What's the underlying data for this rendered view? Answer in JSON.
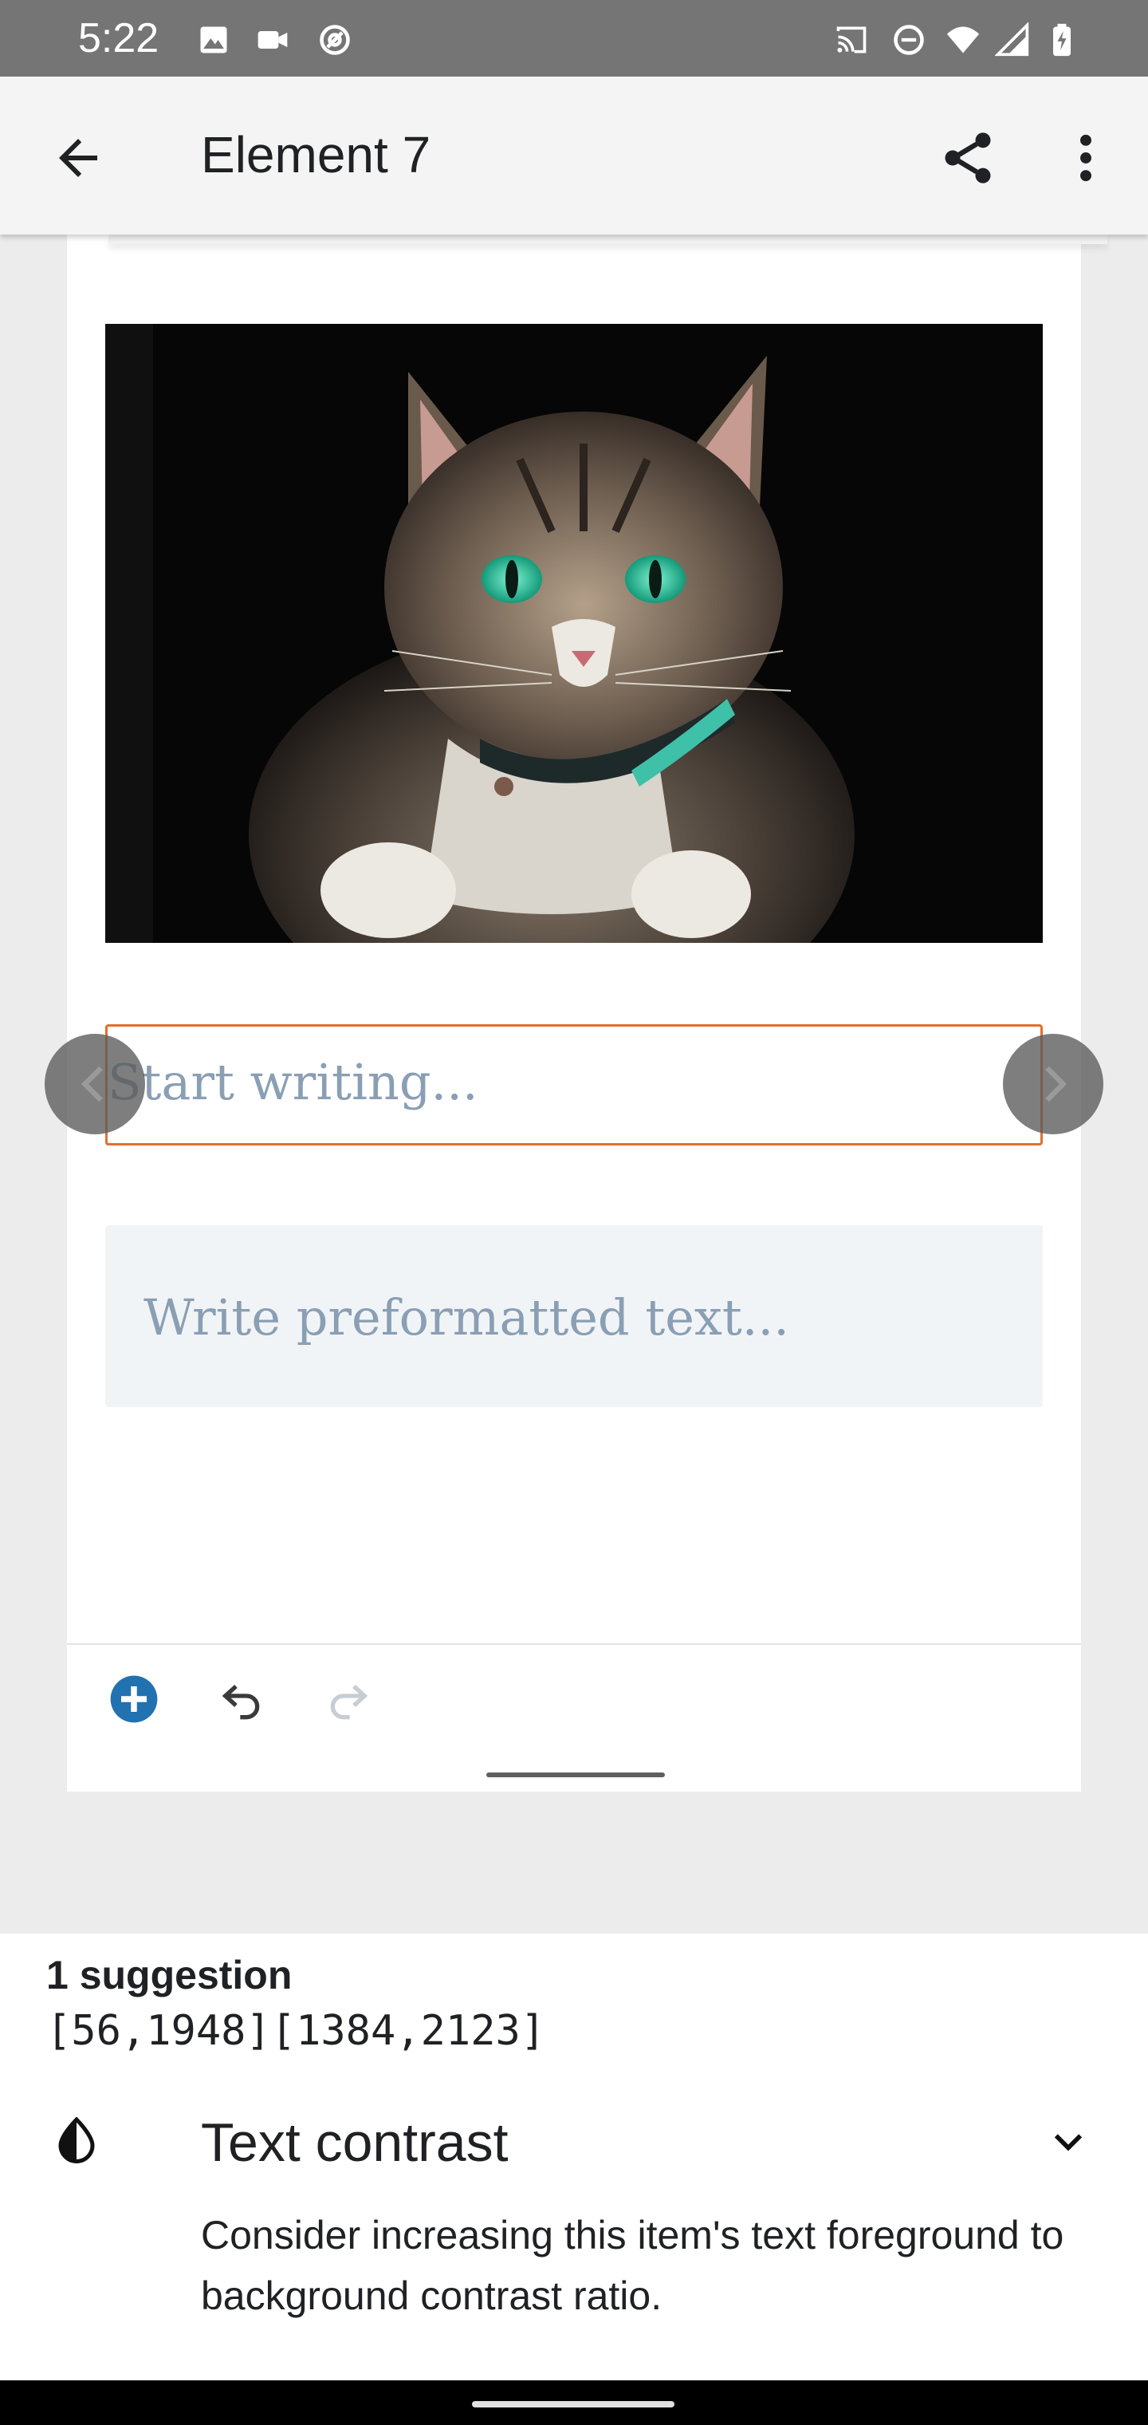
{
  "status_bar": {
    "time": "5:22",
    "left_icons": [
      "image-icon",
      "video-camera-icon",
      "at-sign-icon"
    ],
    "right_icons": [
      "cast-icon",
      "do-not-disturb-icon",
      "wifi-icon",
      "cell-signal-icon",
      "battery-icon"
    ]
  },
  "app_bar": {
    "title": "Element 7",
    "back_icon": "arrow-left-icon",
    "share_icon": "share-icon",
    "more_icon": "more-vert-icon"
  },
  "editor": {
    "paragraph_placeholder": "Start writing...",
    "preformatted_placeholder": "Write preformatted text...",
    "toolbar": {
      "add_icon": "plus-circle-icon",
      "undo_icon": "undo-icon",
      "redo_icon": "redo-icon"
    }
  },
  "suggestions": {
    "count_label": "1 suggestion",
    "bounds": "[56,1948][1384,2123]",
    "item": {
      "icon": "contrast-icon",
      "title": "Text contrast",
      "description": "Consider increasing this item's text foreground to background contrast ratio.",
      "expand_icon": "chevron-down-icon"
    }
  },
  "colors": {
    "accent_orange": "#e26f2c",
    "placeholder": "#8a9fb4",
    "add_button_blue": "#2271b1"
  }
}
